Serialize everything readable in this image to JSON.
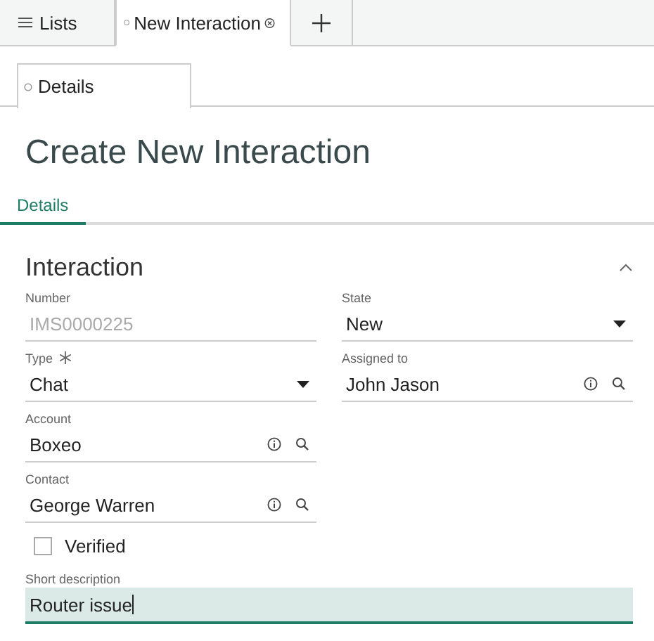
{
  "tabs": [
    {
      "label": "Lists",
      "kind": "list",
      "selected": false
    },
    {
      "label": "New Interaction",
      "kind": "record",
      "selected": true
    },
    {
      "kind": "add",
      "selected": false
    }
  ],
  "subtabs": [
    {
      "label": "Details",
      "selected": true
    }
  ],
  "page_title": "Create New Interaction",
  "sections_nav": [
    {
      "label": "Details",
      "selected": true
    }
  ],
  "section": {
    "title": "Interaction",
    "expanded": true,
    "rows": [
      [
        {
          "label": "Number",
          "value": "IMS0000225",
          "kind": "text",
          "disabled": true,
          "required": false
        },
        {
          "label": "State",
          "value": "New",
          "kind": "select",
          "disabled": false,
          "required": false
        }
      ],
      [
        {
          "label": "Type",
          "value": "Chat",
          "kind": "select",
          "disabled": false,
          "required": true
        },
        {
          "label": "Assigned to",
          "value": "John Jason",
          "kind": "reference",
          "disabled": false,
          "required": false
        }
      ],
      [
        {
          "label": "Account",
          "value": "Boxeo",
          "kind": "reference",
          "disabled": false,
          "required": false
        }
      ],
      [
        {
          "label": "Contact",
          "value": "George Warren",
          "kind": "reference",
          "disabled": false,
          "required": false
        }
      ],
      [
        {
          "label": "Verified",
          "kind": "checkbox",
          "checked": false
        }
      ],
      [
        {
          "label": "Short description",
          "value": "Router issue",
          "kind": "wide",
          "disabled": false,
          "required": false,
          "focused": true
        }
      ]
    ]
  }
}
